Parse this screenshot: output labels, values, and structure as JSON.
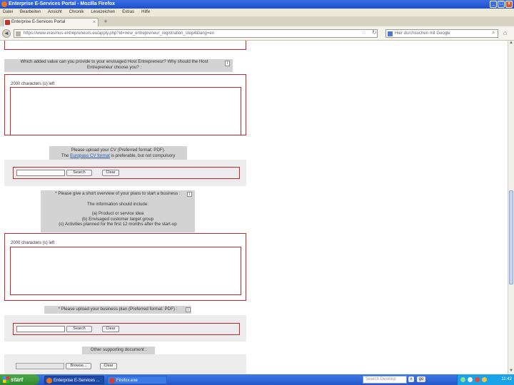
{
  "window": {
    "title": "Enterprise E-Services Portal - Mozilla Firefox",
    "buttons": [
      "_",
      "□",
      "×"
    ]
  },
  "menu": [
    "Datei",
    "Bearbeiten",
    "Ansicht",
    "Chronik",
    "Lesezeichen",
    "Extras",
    "Hilfe"
  ],
  "tab": {
    "label": "Enterprise E-Services Portal",
    "close": "×",
    "new": "+"
  },
  "nav": {
    "back": "◄",
    "url": "https://www.erasmus-entrepreneurs.eu/apply.php?id=new_entrepreneur_registration_step4&lang=en",
    "star": "☆",
    "reload": "↻",
    "search_placeholder": "Hier durchsuchen mit Google",
    "search_go": "⌕",
    "home": "⌂"
  },
  "form": {
    "q_value_text": "Which added value can you provide to your envisaged Host Entrepreneur? Why should the Host Entrepreneur choose you? :",
    "info": "i",
    "counter_1": "2000 characters (s) left",
    "cv_line1": "Please upload your CV (Preferred format: PDF).",
    "cv_line2_pre": "The",
    "cv_link": "Europass CV format",
    "cv_line2_post": "is preferable, but not compulsory",
    "browse": "Search",
    "clear": "Clear",
    "overview_line1": "* Please give a short overview of your plans to start a business :",
    "overview_line2": "The information should include:",
    "overview_a": "(a) Product or service idea",
    "overview_b": "(b) Envisaged customer target group",
    "overview_c": "(c) Activities planned for the first 12 months after the start-up",
    "counter_2": "2000 characters (s) left",
    "bplan_text": "* Please upload your business plan (Preferred format: PDF) :",
    "other_docs": "Other supporting document :",
    "browse_3": "Browse...",
    "clear_3": "Clear"
  },
  "taskbar": {
    "start": "start",
    "tasks": [
      "Enterprise E-Services ...",
      "Firefox.exe"
    ],
    "search_placeholder": "Search Desktop",
    "search_icon": "⌕",
    "search_go": "go",
    "clock": "11:42"
  },
  "colors": {
    "error_border": "#c4262e",
    "panel_bg": "#ececec",
    "header_bg": "#d3d3d3",
    "link": "#2a5db0"
  }
}
